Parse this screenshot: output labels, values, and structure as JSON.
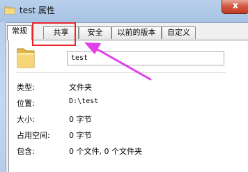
{
  "window": {
    "title": "test 属性",
    "close_label": "x"
  },
  "tabs": [
    {
      "label": "常规",
      "active": true
    },
    {
      "label": "共享",
      "active": false
    },
    {
      "label": "安全",
      "active": false
    },
    {
      "label": "以前的版本",
      "active": false
    },
    {
      "label": "自定义",
      "active": false
    }
  ],
  "general": {
    "name_value": "test",
    "rows": [
      {
        "label": "类型:",
        "value": "文件夹"
      },
      {
        "label": "位置:",
        "value": "D:\\test"
      },
      {
        "label": "大小:",
        "value": "0 字节"
      },
      {
        "label": "占用空间:",
        "value": "0 字节"
      },
      {
        "label": "包含:",
        "value": "0 个文件, 0 个文件夹"
      }
    ]
  },
  "annotation": {
    "highlight_color": "#e8262a",
    "arrow_color": "#e040e8"
  }
}
